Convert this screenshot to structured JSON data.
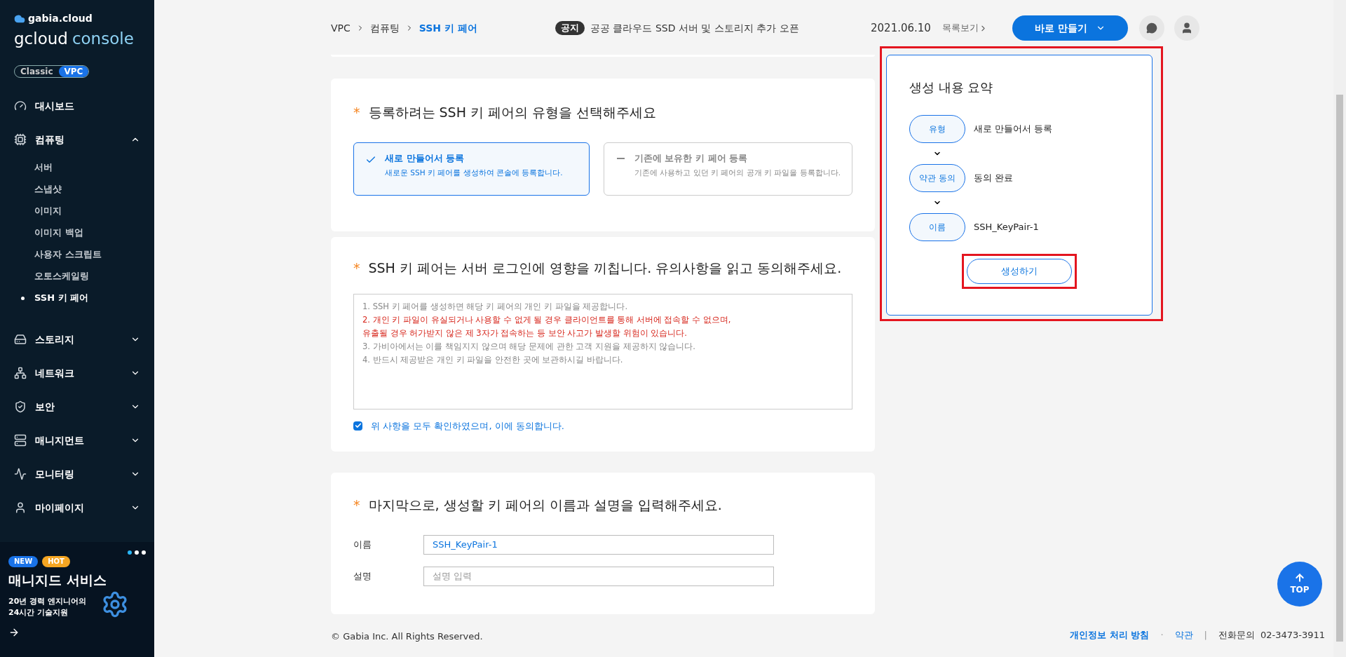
{
  "sidebar": {
    "brand": "gabia.cloud",
    "product": "gcloud",
    "product_suffix": "console",
    "mode_toggle": [
      {
        "label": "Classic",
        "selected": false
      },
      {
        "label": "VPC",
        "selected": true
      }
    ],
    "items": [
      {
        "label": "대시보드",
        "has_children": false
      },
      {
        "label": "컴퓨팅",
        "expanded": true,
        "has_children": true,
        "children": [
          {
            "label": "서버",
            "selected": false
          },
          {
            "label": "스냅샷",
            "selected": false
          },
          {
            "label": "이미지",
            "selected": false
          },
          {
            "label": "이미지 백업",
            "selected": false
          },
          {
            "label": "사용자 스크립트",
            "selected": false
          },
          {
            "label": "오토스케일링",
            "selected": false
          },
          {
            "label": "SSH 키 페어",
            "selected": true
          }
        ]
      },
      {
        "label": "스토리지",
        "expanded": false,
        "has_children": true
      },
      {
        "label": "네트워크",
        "expanded": false,
        "has_children": true
      },
      {
        "label": "보안",
        "expanded": false,
        "has_children": true
      },
      {
        "label": "매니지먼트",
        "expanded": false,
        "has_children": true
      },
      {
        "label": "모니터링",
        "expanded": false,
        "has_children": true
      },
      {
        "label": "마이페이지",
        "expanded": false,
        "has_children": true
      }
    ],
    "banner": {
      "tags": [
        {
          "label": "NEW",
          "color": "#1a73e8"
        },
        {
          "label": "HOT",
          "color": "#f5a623"
        }
      ],
      "title": "매니지드 서비스",
      "lines": [
        "20년 경력 엔지니어의",
        "24시간 기술지원"
      ]
    }
  },
  "header": {
    "breadcrumb": [
      {
        "label": "VPC",
        "current": false
      },
      {
        "label": "컴퓨팅",
        "current": false
      },
      {
        "label": "SSH 키 페어",
        "current": true
      }
    ],
    "notice": {
      "badge": "공지",
      "text": "공공 클라우드 SSD 서버 및 스토리지 추가 오픈",
      "date": "2021.06.10",
      "link": "목록보기"
    },
    "create_button": "바로 만들기"
  },
  "type_section": {
    "required_mark": "*",
    "title": "등록하려는 SSH 키 페어의 유형을 선택해주세요",
    "options": [
      {
        "title": "새로 만들어서 등록",
        "description": "새로운 SSH 키 페어를 생성하여 콘솔에 등록합니다.",
        "selected": true
      },
      {
        "title": "기존에 보유한 키 페어 등록",
        "description": "기존에 사용하고 있던 키 페어의 공개 키 파일을 등록합니다.",
        "selected": false
      }
    ]
  },
  "agreement_section": {
    "required_mark": "*",
    "title": "SSH 키 페어는 서버 로그인에 영향을 끼칩니다. 유의사항을 읽고 동의해주세요.",
    "notes": [
      {
        "text": "1. SSH 키 페어를 생성하면 해당 키 페어의 개인 키 파일을 제공합니다.",
        "warning": false
      },
      {
        "text": "2. 개인 키 파일이 유실되거나 사용할 수 없게 될 경우 클라이언트를 통해 서버에 접속할 수 없으며,",
        "warning": true
      },
      {
        "text": "유출될 경우 허가받지 않은 제 3자가 접속하는 등 보안 사고가 발생할 위험이 있습니다.",
        "warning": true
      },
      {
        "text": "3. 가비아에서는 이를 책임지지 않으며 해당 문제에 관한 고객 지원을 제공하지 않습니다.",
        "warning": false
      },
      {
        "text": "4. 반드시 제공받은 개인 키 파일을 안전한 곳에 보관하시길 바랍니다.",
        "warning": false
      }
    ],
    "consent": {
      "label": "위 사항을 모두 확인하였으며, 이에 동의합니다.",
      "checked": true
    }
  },
  "name_section": {
    "required_mark": "*",
    "title": "마지막으로, 생성할 키 페어의 이름과 설명을 입력해주세요.",
    "fields": [
      {
        "label": "이름",
        "value": "SSH_KeyPair-1"
      },
      {
        "label": "설명",
        "placeholder": "설명 입력"
      }
    ]
  },
  "summary": {
    "title": "생성 내용 요약",
    "highlighted": true,
    "rows": [
      {
        "label": "유형",
        "value": "새로 만들어서 등록"
      },
      {
        "label": "약관 동의",
        "value": "동의 완료"
      },
      {
        "label": "이름",
        "value": "SSH_KeyPair-1"
      }
    ],
    "button": {
      "label": "생성하기",
      "highlighted": true
    }
  },
  "footer": {
    "copyright": "© Gabia Inc. All Rights Reserved.",
    "links": [
      "개인정보 처리 방침",
      "약관"
    ],
    "link_separator": "·",
    "divider": "|",
    "phone_label": "전화문의",
    "phone": "02-3473-3911"
  },
  "top_button": "TOP"
}
